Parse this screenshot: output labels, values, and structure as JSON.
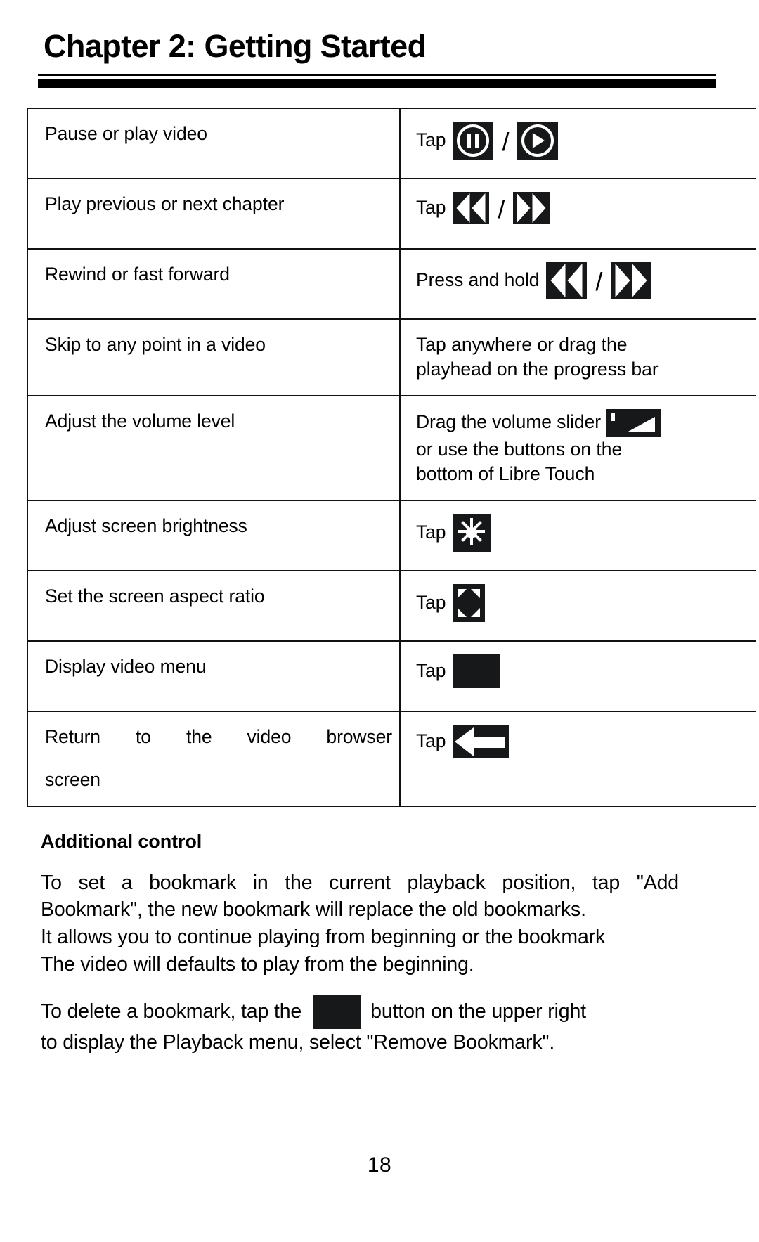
{
  "header": {
    "chapter_title": "Chapter 2: Getting Started"
  },
  "control_table": {
    "rows": [
      {
        "action": "Pause or play video",
        "verb": "Tap",
        "icons": [
          "pause-icon",
          "play-icon"
        ],
        "separator": "/"
      },
      {
        "action": "Play previous or next chapter",
        "verb": "Tap",
        "icons": [
          "previous-chapter-icon",
          "next-chapter-icon"
        ],
        "separator": "/"
      },
      {
        "action": "Rewind or fast forward",
        "verb": "Press and hold",
        "icons": [
          "rewind-icon",
          "fast-forward-icon"
        ],
        "separator": "/"
      },
      {
        "action": "Skip to any point in a video",
        "how_line1": "Tap anywhere or drag the",
        "how_line2": "playhead on the progress bar"
      },
      {
        "action": "Adjust the volume level",
        "how_line1": "Drag the volume slider",
        "how_line2": "or use the buttons on the",
        "how_line3": "bottom of Libre Touch",
        "icons": [
          "volume-slider-icon"
        ]
      },
      {
        "action": "Adjust screen brightness",
        "verb": "Tap",
        "icons": [
          "brightness-icon"
        ]
      },
      {
        "action": "Set the screen aspect ratio",
        "verb": "Tap",
        "icons": [
          "aspect-ratio-icon"
        ]
      },
      {
        "action": "Display video menu",
        "verb": "Tap",
        "icons": [
          "menu-icon"
        ]
      },
      {
        "action_line1": "Return   to   the   video   browser",
        "action_line2": "screen",
        "verb": "Tap",
        "icons": [
          "back-arrow-icon"
        ]
      }
    ]
  },
  "additional_control": {
    "heading": "Additional control",
    "paragraph1_line1": "To  set  a  bookmark  in  the  current  playback  position,  tap  \"Add",
    "paragraph1_line2": "Bookmark\", the new bookmark will replace the old bookmarks.",
    "paragraph1_line3": "It allows you to continue playing from beginning or the bookmark",
    "paragraph1_line4": "The video will defaults to play from the beginning.",
    "paragraph2_before_icon": "To  delete  a  bookmark,  tap  the",
    "paragraph2_icon": "menu-icon",
    "paragraph2_after_icon": "button  on  the  upper  right",
    "paragraph2_line2": "to display the Playback menu, select \"Remove Bookmark\"."
  },
  "footer": {
    "page_number": "18"
  },
  "colors": {
    "text": "#000000",
    "icon_tile_background": "#17181a",
    "icon_glyph": "#ffffff",
    "rule": "#000000",
    "table_border": "#111111"
  }
}
